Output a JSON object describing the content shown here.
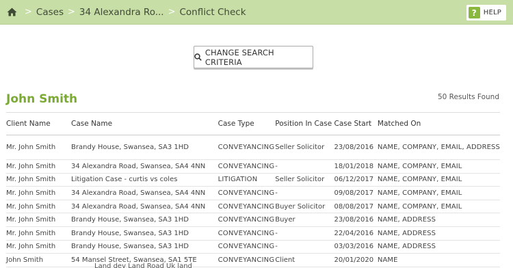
{
  "breadcrumb": {
    "home_icon": "home-icon",
    "items": [
      "Cases",
      "34 Alexandra Ro...",
      "Conflict Check"
    ],
    "separator": ">"
  },
  "help": {
    "icon": "?",
    "label": "HELP"
  },
  "search": {
    "label": "CHANGE SEARCH CRITERIA",
    "icon": "search-icon"
  },
  "client_name": "John Smith",
  "results_count": "50 Results Found",
  "table": {
    "headers": [
      "Client Name",
      "Case Name",
      "Case Type",
      "Position In Case",
      "Case Start",
      "Matched On"
    ],
    "rows": [
      {
        "client": "Mr. John Smith",
        "case": "Brandy House, Swansea, SA3 1HD",
        "type": "CONVEYANCING",
        "position": "Seller Solicitor",
        "start": "23/08/2016",
        "matched": "NAME, COMPANY, EMAIL, ADDRESS"
      },
      {
        "client": "Mr. John Smith",
        "case": "34 Alexandra Road, Swansea, SA4 4NN",
        "type": "CONVEYANCING",
        "position": "-",
        "start": "18/01/2018",
        "matched": "NAME, COMPANY, EMAIL"
      },
      {
        "client": "Mr. John Smith",
        "case": "Litigation Case - curtis vs coles",
        "type": "LITIGATION",
        "position": "Seller Solicitor",
        "start": "06/12/2017",
        "matched": "NAME, COMPANY, EMAIL"
      },
      {
        "client": "Mr. John Smith",
        "case": "34 Alexandra Road, Swansea, SA4 4NN",
        "type": "CONVEYANCING",
        "position": "-",
        "start": "09/08/2017",
        "matched": "NAME, COMPANY, EMAIL"
      },
      {
        "client": "Mr. John Smith",
        "case": "34 Alexandra Road, Swansea, SA4 4NN",
        "type": "CONVEYANCING",
        "position": "Buyer Solicitor",
        "start": "08/08/2017",
        "matched": "NAME, COMPANY, EMAIL"
      },
      {
        "client": "Mr. John Smith",
        "case": "Brandy House, Swansea, SA3 1HD",
        "type": "CONVEYANCING",
        "position": "Buyer",
        "start": "23/08/2016",
        "matched": "NAME, ADDRESS"
      },
      {
        "client": "Mr. John Smith",
        "case": "Brandy House, Swansea, SA3 1HD",
        "type": "CONVEYANCING",
        "position": "-",
        "start": "22/04/2016",
        "matched": "NAME, ADDRESS"
      },
      {
        "client": "Mr. John Smith",
        "case": "Brandy House, Swansea, SA3 1HD",
        "type": "CONVEYANCING",
        "position": "-",
        "start": "03/03/2016",
        "matched": "NAME, ADDRESS"
      },
      {
        "client": "John Smith",
        "case": "54 Mansel Street, Swansea, SA1 5TE",
        "type": "CONVEYANCING",
        "position": "Client",
        "start": "20/01/2020",
        "matched": "NAME"
      }
    ],
    "partial_row_text": "Land dev Land Road Uk land"
  },
  "colors": {
    "topbar": "#c7dea6",
    "accent_green": "#7aaa32",
    "help_icon": "#8ab83f"
  }
}
